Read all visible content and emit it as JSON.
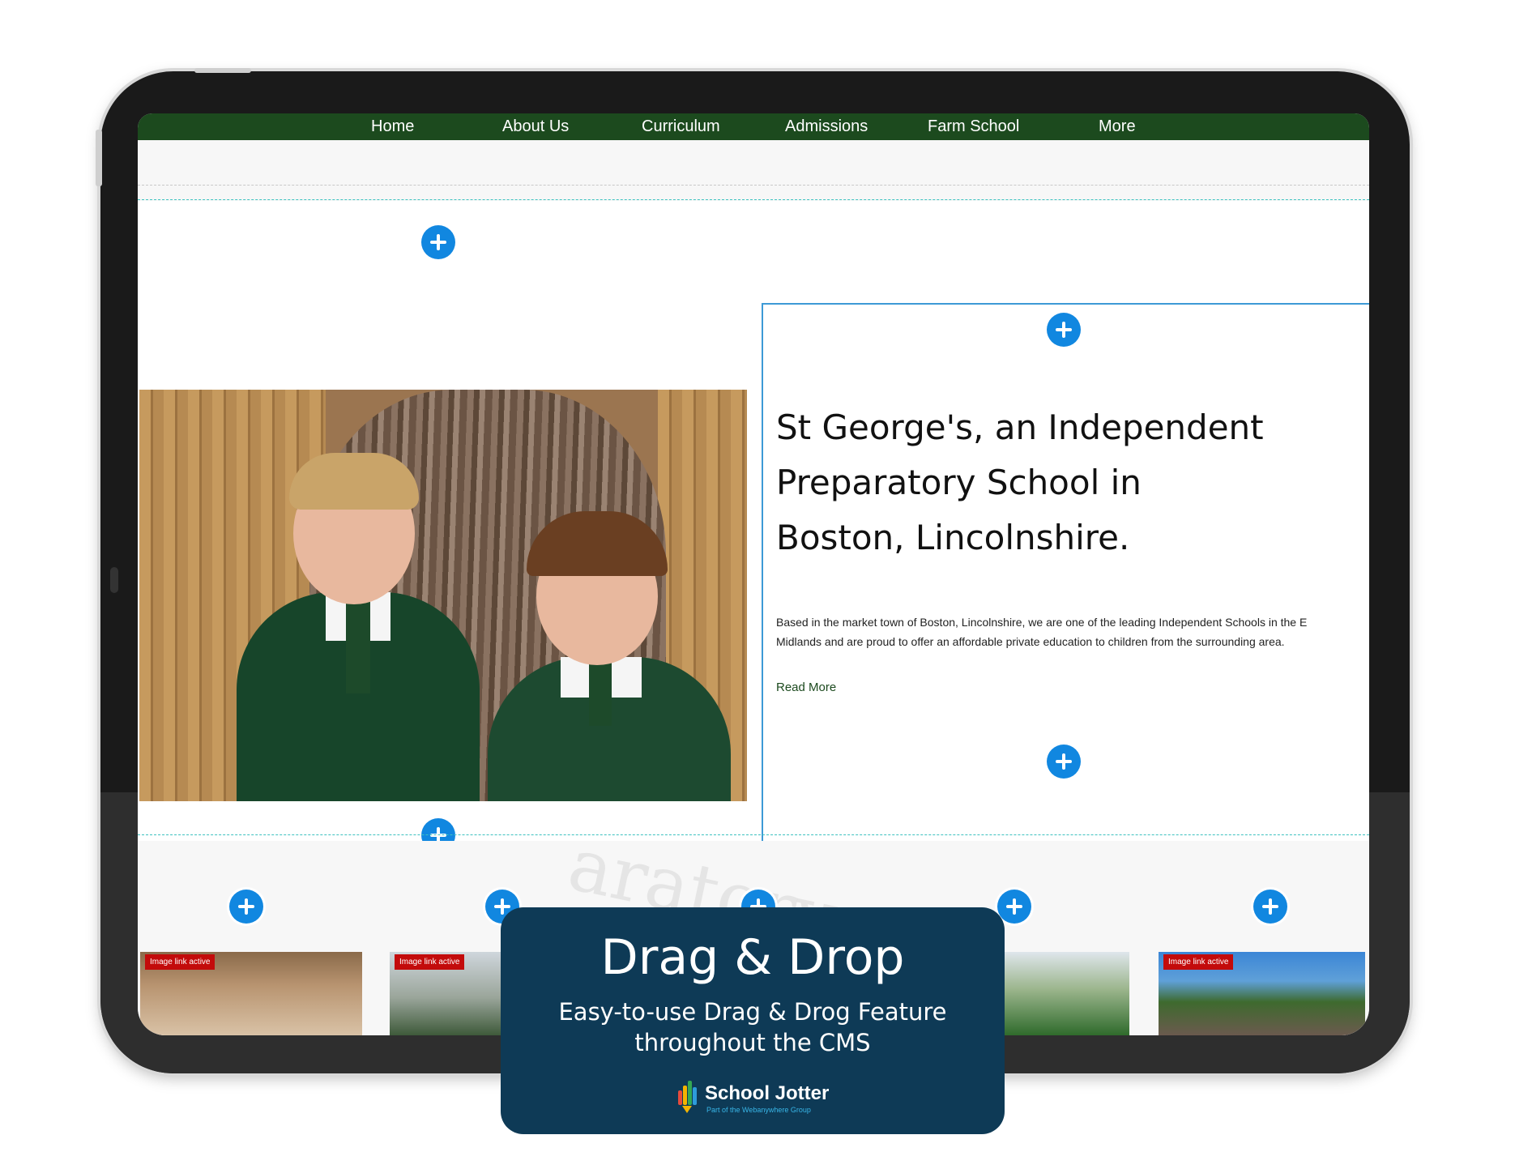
{
  "nav": {
    "items": [
      "Home",
      "About Us",
      "Curriculum",
      "Admissions",
      "Farm School",
      "More"
    ]
  },
  "hero": {
    "headline": "St George's, an Independent Preparatory School in Boston, Lincolnshire.",
    "body": "Based in the market town of Boston, Lincolnshire, we  are one of the leading Independent Schools in the E\nMidlands and are proud to offer an affordable private education to children from the surrounding area.",
    "read_more": "Read More",
    "image_icon": "school-children-photo"
  },
  "watermark": "aratory",
  "thumbnails": {
    "badge": "Image link active",
    "count_visible": 5
  },
  "promo": {
    "title": "Drag & Drop",
    "subtitle": "Easy-to-use Drag & Drog Feature throughout the CMS",
    "brand_name": "School Jotter",
    "brand_tag": "Part of the Webanywhere Group"
  },
  "colors": {
    "nav_green": "#1c4a1e",
    "plus_blue": "#1187e0",
    "panel_border": "#3d9ad6",
    "card_navy": "#0e3a56",
    "badge_red": "#c30b0b"
  },
  "icons": {
    "add": "plus-circle-icon"
  }
}
